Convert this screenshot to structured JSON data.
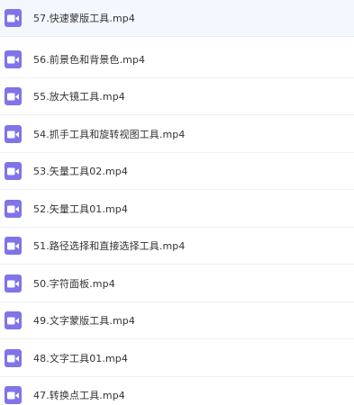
{
  "icon": {
    "name": "video-file-icon",
    "color": "#7f74e8"
  },
  "files": [
    {
      "name": "57.快速蒙版工具.mp4",
      "selected": true
    },
    {
      "name": "56.前景色和背景色.mp4",
      "selected": false
    },
    {
      "name": "55.放大镜工具.mp4",
      "selected": false
    },
    {
      "name": "54.抓手工具和旋转视图工具.mp4",
      "selected": false
    },
    {
      "name": "53.矢量工具02.mp4",
      "selected": false
    },
    {
      "name": "52.矢量工具01.mp4",
      "selected": false
    },
    {
      "name": "51.路径选择和直接选择工具.mp4",
      "selected": false
    },
    {
      "name": "50.字符面板.mp4",
      "selected": false
    },
    {
      "name": "49.文字蒙版工具.mp4",
      "selected": false
    },
    {
      "name": "48.文字工具01.mp4",
      "selected": false
    },
    {
      "name": "47.转换点工具.mp4",
      "selected": false
    }
  ]
}
